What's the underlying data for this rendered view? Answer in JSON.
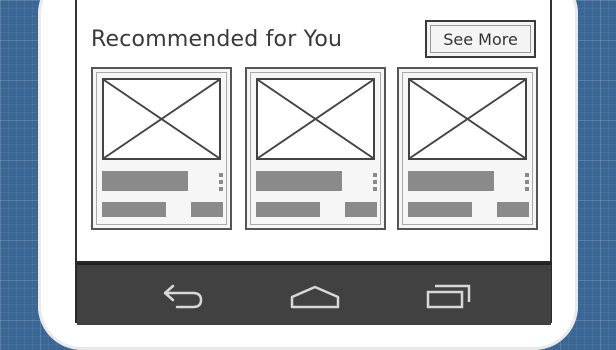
{
  "section": {
    "title": "Recommended for You",
    "see_more_label": "See More"
  },
  "cards": [
    {
      "image": "placeholder-image-icon"
    },
    {
      "image": "placeholder-image-icon"
    },
    {
      "image": "placeholder-image-icon"
    }
  ],
  "nav": {
    "back_icon": "back-icon",
    "home_icon": "home-icon",
    "recents_icon": "recent-apps-icon"
  },
  "colors": {
    "background": "#3a6796",
    "nav_bar": "#414141",
    "placeholder_text": "#8a8a8a"
  }
}
